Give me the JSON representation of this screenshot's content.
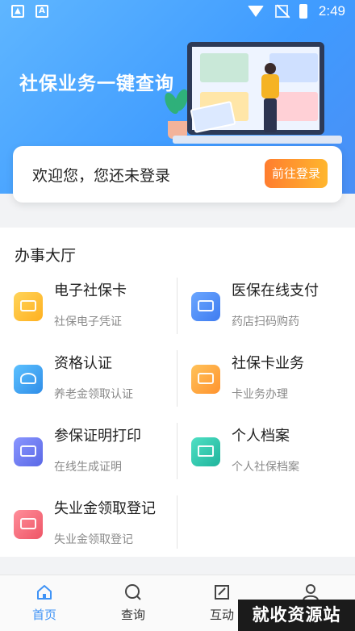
{
  "status_bar": {
    "time": "2:49"
  },
  "hero": {
    "title": "社保业务一键查询"
  },
  "login": {
    "text": "欢迎您，您还未登录",
    "button": "前往登录"
  },
  "hall": {
    "title": "办事大厅",
    "services": [
      {
        "title": "电子社保卡",
        "subtitle": "社保电子凭证",
        "icon": "social-card-icon",
        "color": "#ffbe2e"
      },
      {
        "title": "医保在线支付",
        "subtitle": "药店扫码购药",
        "icon": "payment-card-icon",
        "color": "#4a8cf7"
      },
      {
        "title": "资格认证",
        "subtitle": "养老金领取认证",
        "icon": "user-verify-icon",
        "color": "#3fa4f5"
      },
      {
        "title": "社保卡业务",
        "subtitle": "卡业务办理",
        "icon": "card-business-icon",
        "color": "#ffa53a"
      },
      {
        "title": "参保证明打印",
        "subtitle": "在线生成证明",
        "icon": "printer-icon",
        "color": "#6f7ff0"
      },
      {
        "title": "个人档案",
        "subtitle": "个人社保档案",
        "icon": "graduation-cap-icon",
        "color": "#2ec7b0"
      },
      {
        "title": "失业金领取登记",
        "subtitle": "失业金领取登记",
        "icon": "money-wallet-icon",
        "color": "#f26b7a"
      }
    ]
  },
  "tabbar": {
    "tabs": [
      {
        "label": "首页",
        "icon": "home-icon",
        "active": true
      },
      {
        "label": "查询",
        "icon": "search-icon",
        "active": false
      },
      {
        "label": "互动",
        "icon": "edit-icon",
        "active": false
      },
      {
        "label": "",
        "icon": "user-icon",
        "active": false
      }
    ]
  },
  "watermark": "就收资源站",
  "colors": {
    "primary": "#3f93f6",
    "login_button_start": "#ff7d2f",
    "login_button_end": "#ffb62e"
  }
}
